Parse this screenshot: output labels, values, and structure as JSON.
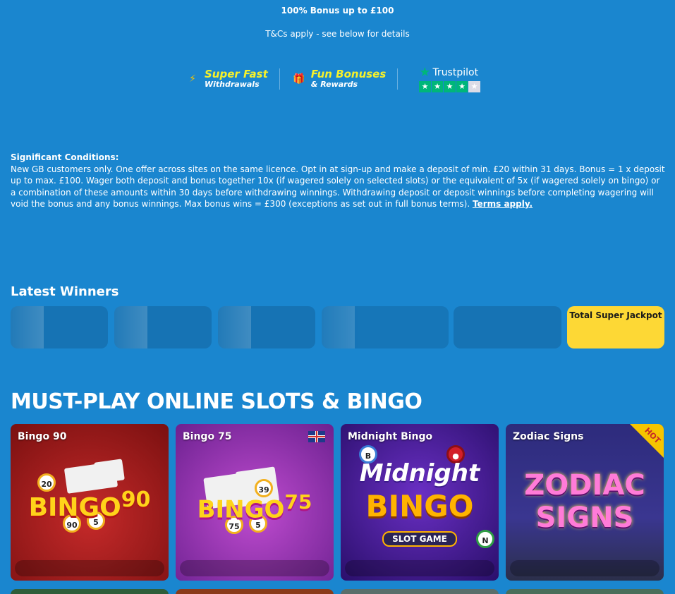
{
  "promo": {
    "bonus_title": "100% Bonus up to £100",
    "tc_line": "T&Cs apply - see below for details"
  },
  "features": [
    {
      "icon": "lightning-icon",
      "title": "Super Fast",
      "subtitle": "Withdrawals"
    },
    {
      "icon": "gift-icon",
      "title": "Fun Bonuses",
      "subtitle": "& Rewards"
    }
  ],
  "trustpilot": {
    "brand": "Trustpilot",
    "rating_stars": 4,
    "max_stars": 5
  },
  "conditions": {
    "title": "Significant Conditions:",
    "body": "New GB customers only. One offer across sites on the same licence. Opt in at sign-up and make a deposit of min. £20 within 31 days. Bonus = 1 x deposit up to max. £100. Wager both deposit and bonus together 10x (if wagered solely on selected slots) or the equivalent of 5x (if wagered solely on bingo) or a combination of these amounts within 30 days before withdrawing winnings. Withdrawing deposit or deposit winnings before completing wagering will void the bonus and any bonus winnings. Max bonus wins = £300 (exceptions as set out in full bonus terms).",
    "link": "Terms apply."
  },
  "winners": {
    "title": "Latest Winners",
    "jackpot_label": "Total Super Jackpot"
  },
  "games": {
    "heading": "MUST-PLAY ONLINE SLOTS & BINGO",
    "items": [
      {
        "name": "Bingo 90",
        "art_text": "BINGO",
        "art_num": "90"
      },
      {
        "name": "Bingo 75",
        "art_text": "BINGO",
        "art_num": "75"
      },
      {
        "name": "Midnight Bingo",
        "art_text": "Midnight",
        "art_num": "BINGO",
        "art_sub": "SLOT GAME"
      },
      {
        "name": "Zodiac Signs",
        "art_text": "ZODIAC",
        "art_num": "SIGNS",
        "badge": "HOT"
      }
    ]
  },
  "colors": {
    "background": "#1a86cf",
    "accent_yellow": "#f6f12b",
    "jackpot_yellow": "#fdd835",
    "trustpilot_green": "#00b67a"
  }
}
